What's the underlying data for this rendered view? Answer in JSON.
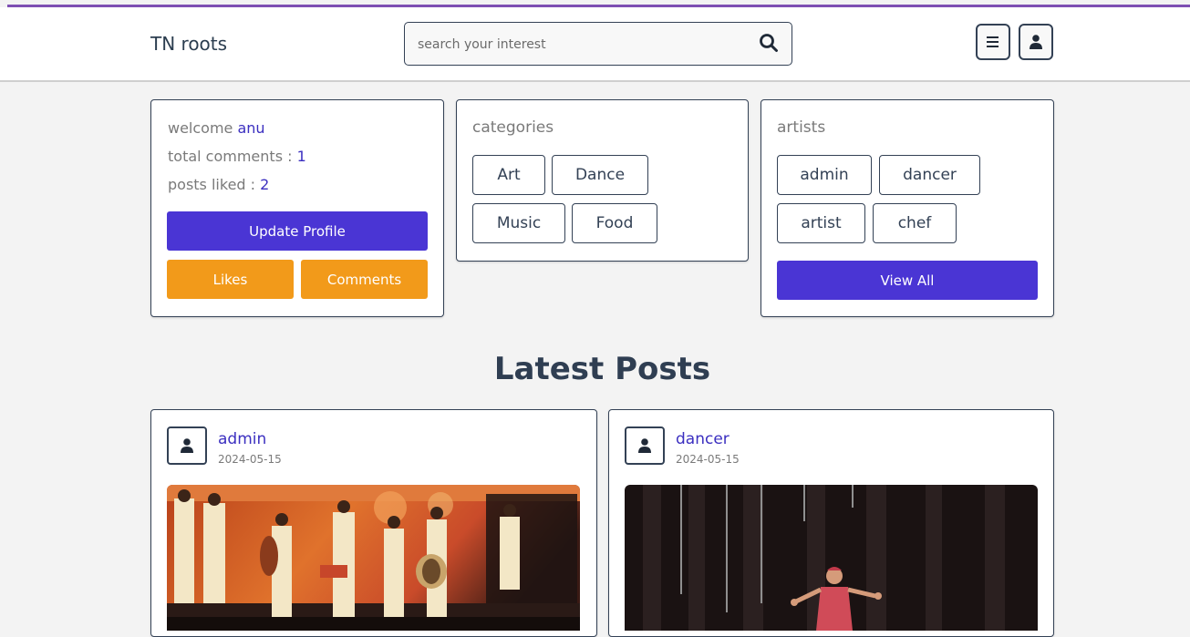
{
  "header": {
    "brand": "TN roots",
    "search_placeholder": "search your interest",
    "search_icon": "search-icon",
    "menu_icon": "menu-icon",
    "user_icon": "user-icon"
  },
  "profile": {
    "welcome_label": "welcome",
    "username": "anu",
    "comments_label": "total comments :",
    "comments_count": "1",
    "liked_label": "posts liked :",
    "liked_count": "2",
    "update_button": "Update Profile",
    "likes_button": "Likes",
    "comments_button": "Comments"
  },
  "categories": {
    "title": "categories",
    "items": [
      "Art",
      "Dance",
      "Music",
      "Food"
    ]
  },
  "artists": {
    "title": "artists",
    "items": [
      "admin",
      "dancer",
      "artist",
      "chef"
    ],
    "view_all_button": "View All"
  },
  "latest": {
    "title": "Latest Posts",
    "posts": [
      {
        "author": "admin",
        "date": "2024-05-15"
      },
      {
        "author": "dancer",
        "date": "2024-05-15"
      }
    ]
  },
  "colors": {
    "accent": "#4a35d4",
    "orange": "#f29a1a",
    "border": "#334155",
    "top_line": "#7e4fb3"
  }
}
